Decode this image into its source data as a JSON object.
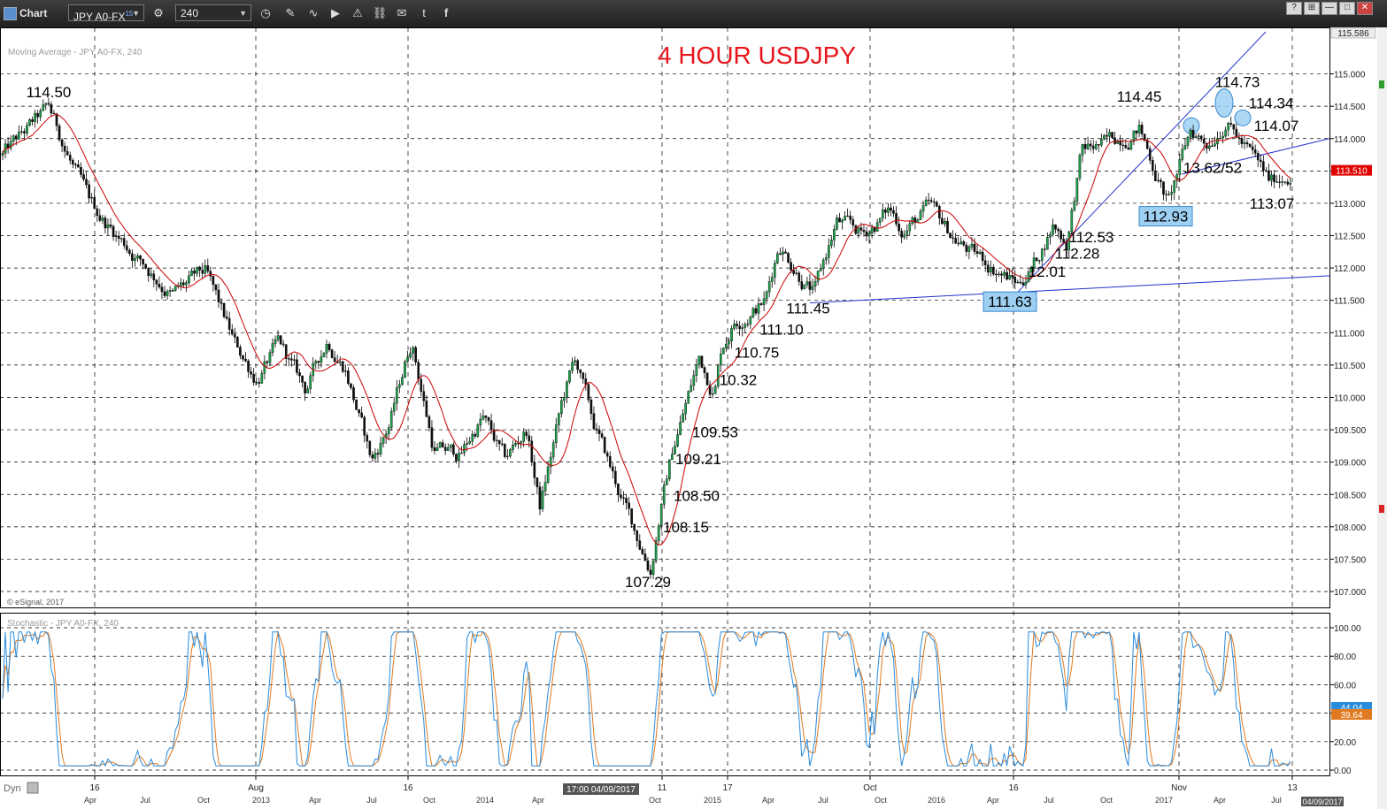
{
  "window": {
    "app_label": "Chart",
    "symbol": "JPY A0-FX",
    "symbol_sup": "15",
    "interval": "240",
    "controls": [
      "—",
      "□",
      "✕"
    ]
  },
  "toolbar_icons": [
    "gear-icon",
    "clock-icon",
    "pencil-icon",
    "squiggle-icon",
    "play-icon",
    "alert-icon",
    "link-icon",
    "chat-icon",
    "twitter-icon",
    "facebook-icon"
  ],
  "colors": {
    "title": "#e8141b",
    "ma_line": "#cc0000",
    "trend_line": "#2233cc",
    "highlight_fill": "#9ed0f3",
    "stoch_k": "#2a8cdc",
    "stoch_d": "#e07a20",
    "price_badge": "#e00000",
    "grid": "#000000"
  },
  "chart_data": [
    {
      "type": "candlestick",
      "title": "4 HOUR USDJPY",
      "indicator_label": "Moving Average - JPY A0-FX, 240",
      "copyright": "© eSignal, 2017",
      "ylim": [
        106.85,
        115.65
      ],
      "y_ticks": [
        "115.000",
        "114.500",
        "114.000",
        "113.500",
        "113.000",
        "112.500",
        "112.000",
        "111.500",
        "111.000",
        "110.500",
        "110.000",
        "109.500",
        "109.000",
        "108.500",
        "108.000",
        "107.500",
        "107.000"
      ],
      "top_price": "115.586",
      "current_price": "113.510",
      "path_x": [
        0,
        55,
        100,
        140,
        195,
        232,
        265,
        290,
        315,
        345,
        370,
        390,
        420,
        440,
        465,
        490,
        520,
        545,
        570,
        595,
        610,
        635,
        650,
        670,
        700,
        735,
        745,
        760,
        775,
        790,
        807,
        815,
        830,
        865,
        880,
        905,
        920,
        945,
        975,
        1005,
        1020,
        1050,
        1075,
        1100,
        1125,
        1150,
        1170,
        1190,
        1205,
        1222,
        1250,
        1287,
        1300,
        1320,
        1345,
        1365,
        1385,
        1400,
        1415,
        1435,
        1458
      ],
      "path_y": [
        113.7,
        114.45,
        113.0,
        112.4,
        111.6,
        111.9,
        110.8,
        110.3,
        110.8,
        110.1,
        110.9,
        110.5,
        109.0,
        109.6,
        110.9,
        109.2,
        109.1,
        109.7,
        109.0,
        109.5,
        108.3,
        109.9,
        110.6,
        109.6,
        108.5,
        107.35,
        108.2,
        109.2,
        109.9,
        110.6,
        110.1,
        110.8,
        111.2,
        111.5,
        112.4,
        111.9,
        111.6,
        112.7,
        112.5,
        112.9,
        112.6,
        112.9,
        112.5,
        112.2,
        112.0,
        111.75,
        112.1,
        112.7,
        112.4,
        113.8,
        113.9,
        114.2,
        113.7,
        113.0,
        114.1,
        113.95,
        114.35,
        114.0,
        113.7,
        113.3,
        113.5
      ],
      "annotations": [
        {
          "label": "114.50",
          "x": 55,
          "y": 114.72
        },
        {
          "label": "107.29",
          "x": 732,
          "y": 107.15
        },
        {
          "label": "108.15",
          "x": 775,
          "y": 108.0
        },
        {
          "label": "108.50",
          "x": 787,
          "y": 108.48
        },
        {
          "label": "109.21",
          "x": 789,
          "y": 109.05
        },
        {
          "label": "109.53",
          "x": 808,
          "y": 109.47
        },
        {
          "label": "10.32",
          "x": 834,
          "y": 110.27
        },
        {
          "label": "110.75",
          "x": 855,
          "y": 110.7
        },
        {
          "label": "111.10",
          "x": 883,
          "y": 111.05
        },
        {
          "label": "111.45",
          "x": 913,
          "y": 111.38
        },
        {
          "label": "12.01",
          "x": 1183,
          "y": 111.95
        },
        {
          "label": "112.28",
          "x": 1217,
          "y": 112.23
        },
        {
          "label": "112.53",
          "x": 1233,
          "y": 112.48
        },
        {
          "label": "114.45",
          "x": 1287,
          "y": 114.65
        },
        {
          "label": "114.73",
          "x": 1398,
          "y": 114.88
        },
        {
          "label": "114.34",
          "x": 1436,
          "y": 114.55
        },
        {
          "label": "114.07",
          "x": 1442,
          "y": 114.2
        },
        {
          "label": "13.62/52",
          "x": 1370,
          "y": 113.55
        },
        {
          "label": "113.07",
          "x": 1437,
          "y": 113.0
        }
      ],
      "boxed_annotations": [
        {
          "label": "111.63",
          "x": 1141,
          "y": 111.48
        },
        {
          "label": "112.93",
          "x": 1317,
          "y": 112.8
        }
      ],
      "trend_lines": [
        {
          "x1": 915,
          "y1": 111.46,
          "x2": 1502,
          "y2": 111.88
        },
        {
          "x1": 1150,
          "y1": 111.63,
          "x2": 1430,
          "y2": 115.65
        },
        {
          "x1": 1335,
          "y1": 113.45,
          "x2": 1502,
          "y2": 114.0
        }
      ],
      "highlight_ellipses": [
        {
          "x": 1346,
          "y": 114.2
        },
        {
          "x": 1383,
          "y": 114.55
        },
        {
          "x": 1404,
          "y": 114.32
        }
      ]
    },
    {
      "type": "line",
      "indicator_label": "Stochastic - JPY A0-FX, 240",
      "ylim": [
        -5,
        103
      ],
      "y_ticks": [
        "100.00",
        "80.00",
        "60.00",
        "40.00",
        "20.00",
        "0.00"
      ],
      "k_value": "44.04",
      "d_value": "39.64",
      "series": [
        {
          "name": "%K",
          "color": "#2a8cdc"
        },
        {
          "name": "%D",
          "color": "#e07a20"
        }
      ]
    }
  ],
  "x_axis": {
    "labels": [
      {
        "text": "16",
        "x": 107
      },
      {
        "text": "Aug",
        "x": 289
      },
      {
        "text": "16",
        "x": 461
      },
      {
        "text": "11",
        "x": 748
      },
      {
        "text": "17",
        "x": 822
      },
      {
        "text": "Oct",
        "x": 983
      },
      {
        "text": "16",
        "x": 1145
      },
      {
        "text": "Nov",
        "x": 1332
      },
      {
        "text": "13",
        "x": 1460
      }
    ],
    "cursor_time": "17:00 04/09/2017",
    "dyn_label": "Dyn",
    "lower_labels": [
      {
        "text": "Apr",
        "x": 102
      },
      {
        "text": "Jul",
        "x": 164
      },
      {
        "text": "Oct",
        "x": 230
      },
      {
        "text": "2013",
        "x": 295
      },
      {
        "text": "Apr",
        "x": 356
      },
      {
        "text": "Jul",
        "x": 420
      },
      {
        "text": "Oct",
        "x": 485
      },
      {
        "text": "2014",
        "x": 548
      },
      {
        "text": "Apr",
        "x": 608
      },
      {
        "text": "Oct",
        "x": 740
      },
      {
        "text": "2015",
        "x": 805
      },
      {
        "text": "Apr",
        "x": 868
      },
      {
        "text": "Jul",
        "x": 930
      },
      {
        "text": "Oct",
        "x": 995
      },
      {
        "text": "2016",
        "x": 1058
      },
      {
        "text": "Apr",
        "x": 1122
      },
      {
        "text": "Jul",
        "x": 1185
      },
      {
        "text": "Oct",
        "x": 1250
      },
      {
        "text": "2017",
        "x": 1315
      },
      {
        "text": "Apr",
        "x": 1378
      },
      {
        "text": "Jul",
        "x": 1442
      }
    ],
    "end_date": "04/09/2017"
  }
}
